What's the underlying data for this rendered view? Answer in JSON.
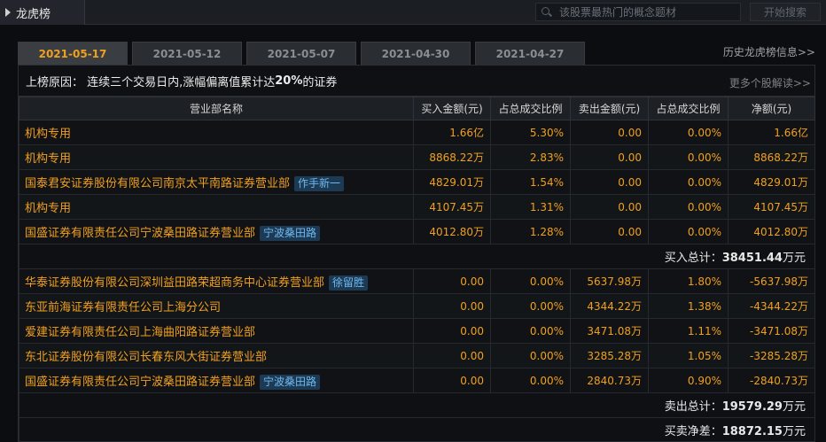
{
  "window": {
    "title": "龙虎榜"
  },
  "search": {
    "placeholder": "该股票最热门的概念题材",
    "button": "开始搜索"
  },
  "tabs": [
    {
      "label": "2021-05-17",
      "active": true
    },
    {
      "label": "2021-05-12",
      "active": false
    },
    {
      "label": "2021-05-07",
      "active": false
    },
    {
      "label": "2021-04-30",
      "active": false
    },
    {
      "label": "2021-04-27",
      "active": false
    }
  ],
  "history_link": "历史龙虎榜信息>>",
  "reason": {
    "prefix": "上榜原因：  连续三个交易日内,涨幅偏离值累计达",
    "bold": "20%",
    "suffix": "的证券"
  },
  "more_link": "更多个股解读>>",
  "columns": [
    "营业部名称",
    "买入金额(元)",
    "占总成交比例",
    "卖出金额(元)",
    "占总成交比例",
    "净额(元)"
  ],
  "buy_rows": [
    {
      "name": "机构专用",
      "tag": "",
      "buy": "1.66亿",
      "buy_pct": "5.30%",
      "sell": "0.00",
      "sell_pct": "0.00%",
      "net": "1.66亿"
    },
    {
      "name": "机构专用",
      "tag": "",
      "buy": "8868.22万",
      "buy_pct": "2.83%",
      "sell": "0.00",
      "sell_pct": "0.00%",
      "net": "8868.22万"
    },
    {
      "name": "国泰君安证券股份有限公司南京太平南路证券营业部",
      "tag": "作手新一",
      "buy": "4829.01万",
      "buy_pct": "1.54%",
      "sell": "0.00",
      "sell_pct": "0.00%",
      "net": "4829.01万"
    },
    {
      "name": "机构专用",
      "tag": "",
      "buy": "4107.45万",
      "buy_pct": "1.31%",
      "sell": "0.00",
      "sell_pct": "0.00%",
      "net": "4107.45万"
    },
    {
      "name": "国盛证券有限责任公司宁波桑田路证券营业部",
      "tag": "宁波桑田路",
      "buy": "4012.80万",
      "buy_pct": "1.28%",
      "sell": "0.00",
      "sell_pct": "0.00%",
      "net": "4012.80万"
    }
  ],
  "buy_total": {
    "label": "买入总计：",
    "value": "38451.44",
    "unit": "万元"
  },
  "sell_rows": [
    {
      "name": "华泰证券股份有限公司深圳益田路荣超商务中心证券营业部",
      "tag": "徐留胜",
      "buy": "0.00",
      "buy_pct": "0.00%",
      "sell": "5637.98万",
      "sell_pct": "1.80%",
      "net": "-5637.98万"
    },
    {
      "name": "东亚前海证券有限责任公司上海分公司",
      "tag": "",
      "buy": "0.00",
      "buy_pct": "0.00%",
      "sell": "4344.22万",
      "sell_pct": "1.38%",
      "net": "-4344.22万"
    },
    {
      "name": "爱建证券有限责任公司上海曲阳路证券营业部",
      "tag": "",
      "buy": "0.00",
      "buy_pct": "0.00%",
      "sell": "3471.08万",
      "sell_pct": "1.11%",
      "net": "-3471.08万"
    },
    {
      "name": "东北证券股份有限公司长春东风大街证券营业部",
      "tag": "",
      "buy": "0.00",
      "buy_pct": "0.00%",
      "sell": "3285.28万",
      "sell_pct": "1.05%",
      "net": "-3285.28万"
    },
    {
      "name": "国盛证券有限责任公司宁波桑田路证券营业部",
      "tag": "宁波桑田路",
      "buy": "0.00",
      "buy_pct": "0.00%",
      "sell": "2840.73万",
      "sell_pct": "0.90%",
      "net": "-2840.73万"
    }
  ],
  "sell_total": {
    "label": "卖出总计：",
    "value": "19579.29",
    "unit": "万元"
  },
  "net_total": {
    "label": "买卖净差：",
    "value": "18872.15",
    "unit": "万元"
  }
}
